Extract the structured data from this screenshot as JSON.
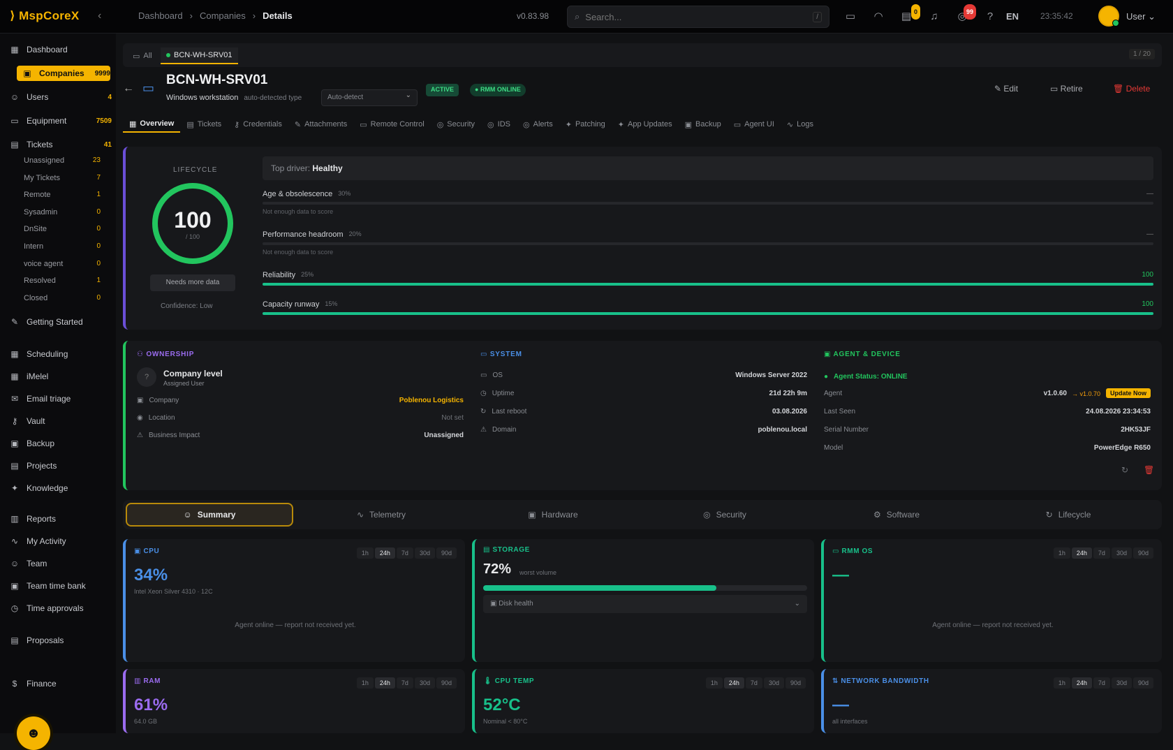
{
  "topbar": {
    "logo": "MspCoreX",
    "breadcrumbs": [
      "Dashboard",
      "Companies",
      "Details"
    ],
    "version": "v0.83.98",
    "search_placeholder": "Search...",
    "search_kbd": "/",
    "badge_tickets": "0",
    "badge_alerts": "99",
    "language": "EN",
    "clock": "23:35:42",
    "user": "User"
  },
  "sidebar": {
    "items": [
      {
        "label": "Dashboard",
        "count": ""
      },
      {
        "label": "Companies",
        "count": "9999"
      },
      {
        "label": "Users",
        "count": "4"
      },
      {
        "label": "Equipment",
        "count": "7509"
      },
      {
        "label": "Tickets",
        "count": "41"
      }
    ],
    "ticket_sub": [
      {
        "label": "Unassigned",
        "count": "23"
      },
      {
        "label": "My Tickets",
        "count": "7"
      },
      {
        "label": "Remote",
        "count": "1"
      },
      {
        "label": "Sysadmin",
        "count": "0"
      },
      {
        "label": "DnSite",
        "count": "0"
      },
      {
        "label": "Intern",
        "count": "0"
      },
      {
        "label": "voice agent",
        "count": "0"
      },
      {
        "label": "Resolved",
        "count": "1"
      },
      {
        "label": "Closed",
        "count": "0"
      }
    ],
    "more": [
      "Getting Started",
      "Scheduling",
      "iMelel",
      "Email triage",
      "Vault",
      "Backup",
      "Projects",
      "Knowledge",
      "Reports",
      "My Activity",
      "Team",
      "Team time bank",
      "Time approvals",
      "Proposals",
      "Finance"
    ]
  },
  "window_tabs": {
    "all": "All",
    "current": "BCN-WH-SRV01",
    "strip_btn": "1 / 20"
  },
  "device": {
    "name": "BCN-WH-SRV01",
    "type": "Windows workstation",
    "detect": "auto-detected type",
    "select": "Auto-detect",
    "status_active": "ACTIVE",
    "status_online": "RMM ONLINE",
    "edit": "Edit",
    "retire": "Retire",
    "delete": "Delete"
  },
  "nav_tabs": [
    "Overview",
    "Tickets",
    "Credentials",
    "Attachments",
    "Remote Control",
    "Security",
    "IDS",
    "Alerts",
    "Patching",
    "App Updates",
    "Backup",
    "Agent UI",
    "Logs"
  ],
  "lifecycle": {
    "label": "LIFECYCLE",
    "score": "100",
    "score_of": "/ 100",
    "needs": "Needs more data",
    "confidence": "Confidence: Low",
    "driver_label": "Top driver:",
    "driver_value": "Healthy",
    "metrics": [
      {
        "label": "Age & obsolescence",
        "pct": "30%",
        "value": "—",
        "fill": 0,
        "note": "Not enough data to score"
      },
      {
        "label": "Performance headroom",
        "pct": "20%",
        "value": "—",
        "fill": 0,
        "note": "Not enough data to score"
      },
      {
        "label": "Reliability",
        "pct": "25%",
        "value": "100",
        "fill": 100,
        "note": ""
      },
      {
        "label": "Capacity runway",
        "pct": "15%",
        "value": "100",
        "fill": 100,
        "note": ""
      }
    ]
  },
  "ownership": {
    "heading": "OWNERSHIP",
    "owner": "Company level",
    "owner_sub": "Assigned User",
    "rows": [
      {
        "k": "Company",
        "v": "Poblenou Logistics"
      },
      {
        "k": "Location",
        "v": "Not set"
      },
      {
        "k": "Business Impact",
        "v": "Unassigned"
      }
    ]
  },
  "system": {
    "heading": "SYSTEM",
    "rows": [
      {
        "k": "OS",
        "v": "Windows Server 2022"
      },
      {
        "k": "Uptime",
        "v": "21d 22h 9m"
      },
      {
        "k": "Last reboot",
        "v": "03.08.2026"
      },
      {
        "k": "Domain",
        "v": "poblenou.local"
      }
    ]
  },
  "agent": {
    "heading": "AGENT & DEVICE",
    "status": "Agent Status: ONLINE",
    "tag": "Update Now",
    "version_old": "v1.0.60",
    "version_new": "→ v1.0.70",
    "rows": [
      {
        "k": "Agent",
        "v": ""
      },
      {
        "k": "Last Seen",
        "v": "24.08.2026 23:34:53"
      },
      {
        "k": "Serial Number",
        "v": "2HK53JF"
      },
      {
        "k": "Model",
        "v": "PowerEdge R650"
      }
    ]
  },
  "sub_tabs": [
    "Summary",
    "Telemetry",
    "Hardware",
    "Security",
    "Software",
    "Lifecycle"
  ],
  "ranges": [
    "1h",
    "24h",
    "7d",
    "30d",
    "90d"
  ],
  "panels": {
    "cpu": {
      "title": "CPU",
      "value": "34%",
      "sub": "Intel Xeon Silver 4310 · 12C",
      "empty": "Agent online — report not received yet."
    },
    "storage": {
      "title": "STORAGE",
      "value": "72%",
      "sub": "worst volume",
      "fill": 72,
      "disk": "Disk health"
    },
    "rmm": {
      "title": "RMM OS",
      "value": "—",
      "empty": "Agent online — report not received yet."
    },
    "ram": {
      "title": "RAM",
      "value": "61%",
      "sub": "64.0 GB"
    },
    "temp": {
      "title": "CPU TEMP",
      "value": "52°C",
      "sub": "Nominal < 80°C"
    },
    "net": {
      "title": "NETWORK BANDWIDTH",
      "value": "—",
      "sub": "all interfaces"
    }
  },
  "colors": {
    "accent": "#f5b400",
    "ok": "#22c55e",
    "blue": "#4a8fe7",
    "purple": "#9b6cf0",
    "teal": "#18c08a",
    "danger": "#e53935"
  }
}
